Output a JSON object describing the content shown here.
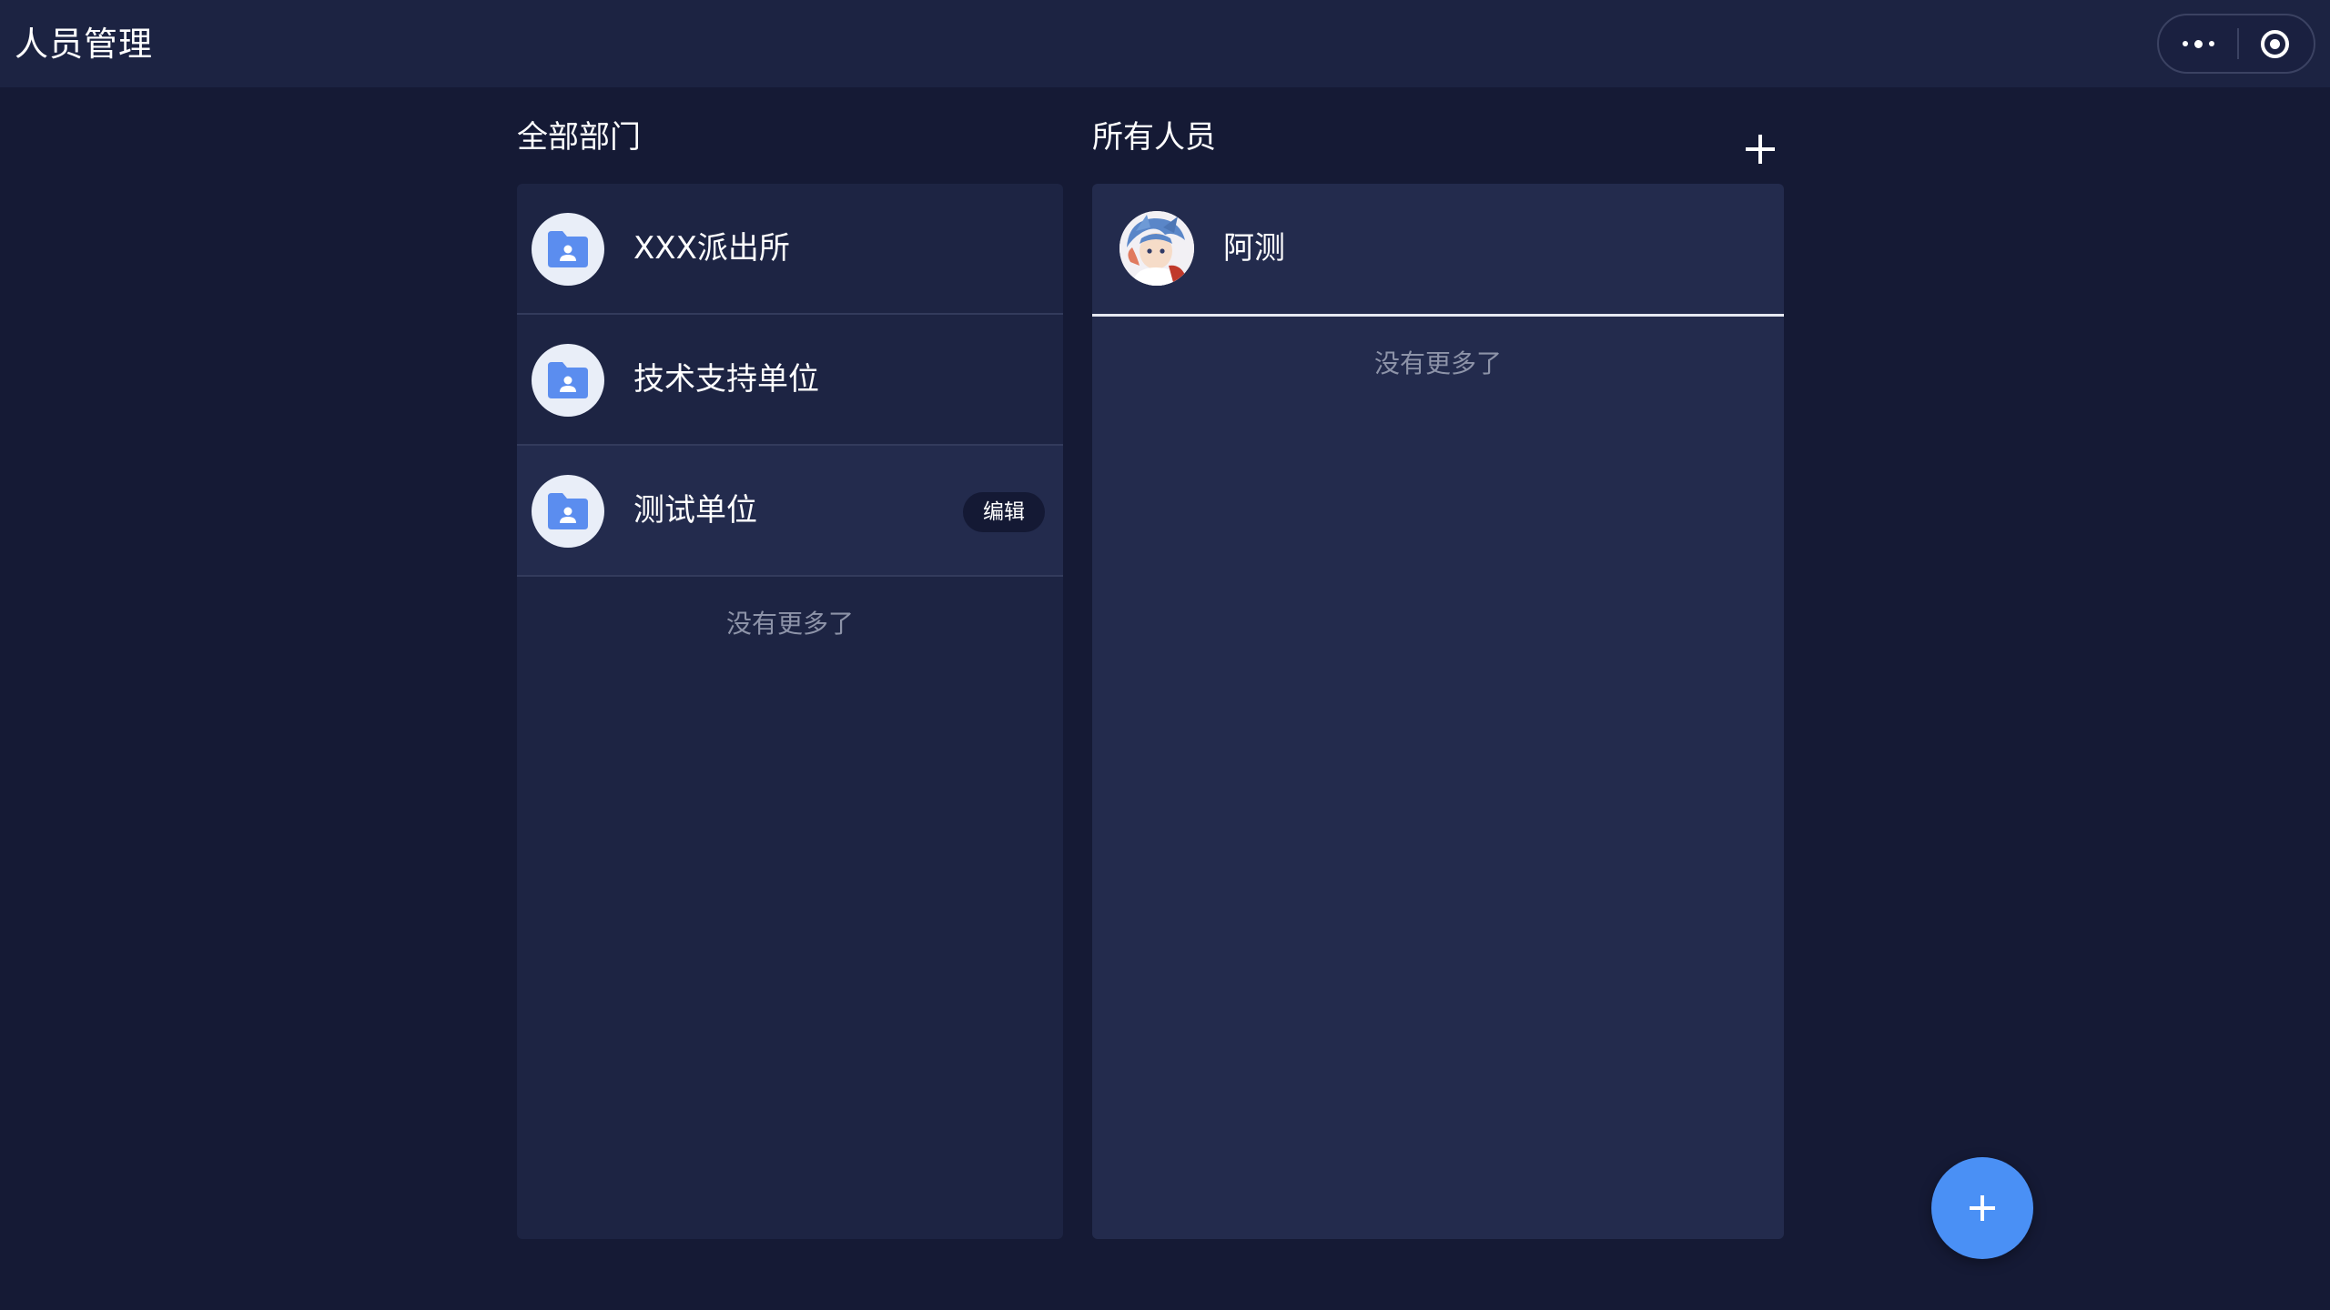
{
  "header": {
    "title": "人员管理",
    "more_icon": "more-dots-icon",
    "target_icon": "record-target-icon"
  },
  "departments": {
    "title": "全部部门",
    "items": [
      {
        "label": "XXX派出所",
        "icon": "folder-user-icon"
      },
      {
        "label": "技术支持单位",
        "icon": "folder-user-icon"
      },
      {
        "label": "测试单位",
        "icon": "folder-user-icon",
        "action_label": "编辑"
      }
    ],
    "footer": "没有更多了"
  },
  "people": {
    "title": "所有人员",
    "add_icon": "plus-icon",
    "items": [
      {
        "name": "阿测",
        "avatar": "anime-character-avatar"
      }
    ],
    "footer": "没有更多了"
  },
  "fab": {
    "icon": "plus-icon"
  },
  "colors": {
    "background": "#151a35",
    "header": "#1c2342",
    "dept_panel": "#1d2443",
    "people_panel": "#232b4d",
    "accent": "#4a90f5",
    "folder_icon": "#5b8def",
    "muted_text": "#8d93a8"
  }
}
